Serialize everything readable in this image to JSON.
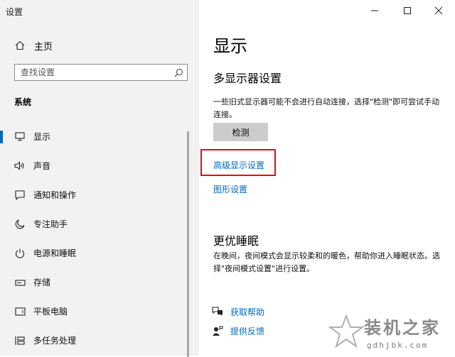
{
  "window": {
    "title": "设置"
  },
  "sidebar": {
    "home_label": "主页",
    "search_placeholder": "查找设置",
    "section_title": "系统",
    "items": [
      {
        "label": "显示",
        "icon": "monitor-icon",
        "active": true
      },
      {
        "label": "声音",
        "icon": "speaker-icon"
      },
      {
        "label": "通知和操作",
        "icon": "notification-icon"
      },
      {
        "label": "专注助手",
        "icon": "moon-icon"
      },
      {
        "label": "电源和睡眠",
        "icon": "power-icon"
      },
      {
        "label": "存储",
        "icon": "storage-icon"
      },
      {
        "label": "平板电脑",
        "icon": "tablet-icon"
      },
      {
        "label": "多任务处理",
        "icon": "multitask-icon"
      }
    ]
  },
  "main": {
    "page_title": "显示",
    "multi_display": {
      "title": "多显示器设置",
      "description": "一些旧式显示器可能不会进行自动连接，选择\"检测\"即可尝试手动连接。",
      "detect_button": "检测",
      "advanced_link": "高级显示设置",
      "graphics_link": "图形设置"
    },
    "sleep": {
      "title": "更优睡眠",
      "description": "在晚间，夜间模式会显示较柔和的暖色，帮助你进入睡眠状态。选择\"夜间模式设置\"进行设置。"
    },
    "help": {
      "get_help": "获取帮助",
      "feedback": "提供反馈"
    }
  },
  "watermark": {
    "text": "装机之家",
    "url": "gdhjbk.com"
  },
  "colors": {
    "accent": "#0067c0",
    "highlight": "#e01010",
    "sidebar_bg": "#f2f2f2"
  }
}
